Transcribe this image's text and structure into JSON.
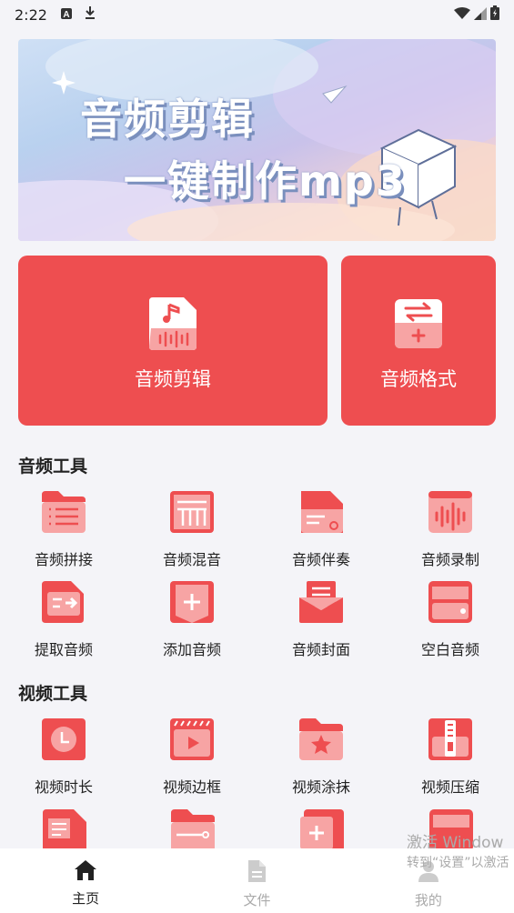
{
  "status_bar": {
    "time": "2:22",
    "icons": [
      "font-icon",
      "download-icon",
      "wifi-icon",
      "signal-icon",
      "battery-icon"
    ]
  },
  "banner": {
    "line1": "音频剪辑",
    "line2": "一键制作mp3"
  },
  "feature_cards": [
    {
      "label": "音频剪辑",
      "icon": "audio-file-icon"
    },
    {
      "label": "音频格式",
      "icon": "format-convert-icon"
    }
  ],
  "audio_tools": {
    "title": "音频工具",
    "items": [
      {
        "label": "音频拼接",
        "icon": "folder-list-icon"
      },
      {
        "label": "音频混音",
        "icon": "mixer-icon"
      },
      {
        "label": "音频伴奏",
        "icon": "accompaniment-file-icon"
      },
      {
        "label": "音频录制",
        "icon": "waveform-icon"
      },
      {
        "label": "提取音频",
        "icon": "extract-icon"
      },
      {
        "label": "添加音频",
        "icon": "add-audio-icon"
      },
      {
        "label": "音频封面",
        "icon": "envelope-icon"
      },
      {
        "label": "空白音频",
        "icon": "blank-disk-icon"
      }
    ]
  },
  "video_tools": {
    "title": "视频工具",
    "items": [
      {
        "label": "视频时长",
        "icon": "clock-icon"
      },
      {
        "label": "视频边框",
        "icon": "video-frame-icon"
      },
      {
        "label": "视频涂抹",
        "icon": "smear-folder-icon"
      },
      {
        "label": "视频压缩",
        "icon": "compress-icon"
      }
    ]
  },
  "watermark": {
    "line1": "激活 Window",
    "line2": "转到“设置”以激活"
  },
  "bottom_nav": [
    {
      "label": "主页",
      "icon": "home-icon",
      "active": true
    },
    {
      "label": "文件",
      "icon": "file-icon",
      "active": false
    },
    {
      "label": "我的",
      "icon": "person-icon",
      "active": false
    }
  ],
  "colors": {
    "accent": "#ee4e50",
    "accent_light": "#f7a4a4",
    "background": "#f4f4f8",
    "nav_active": "#222222",
    "nav_inactive": "#aaaaaa"
  }
}
